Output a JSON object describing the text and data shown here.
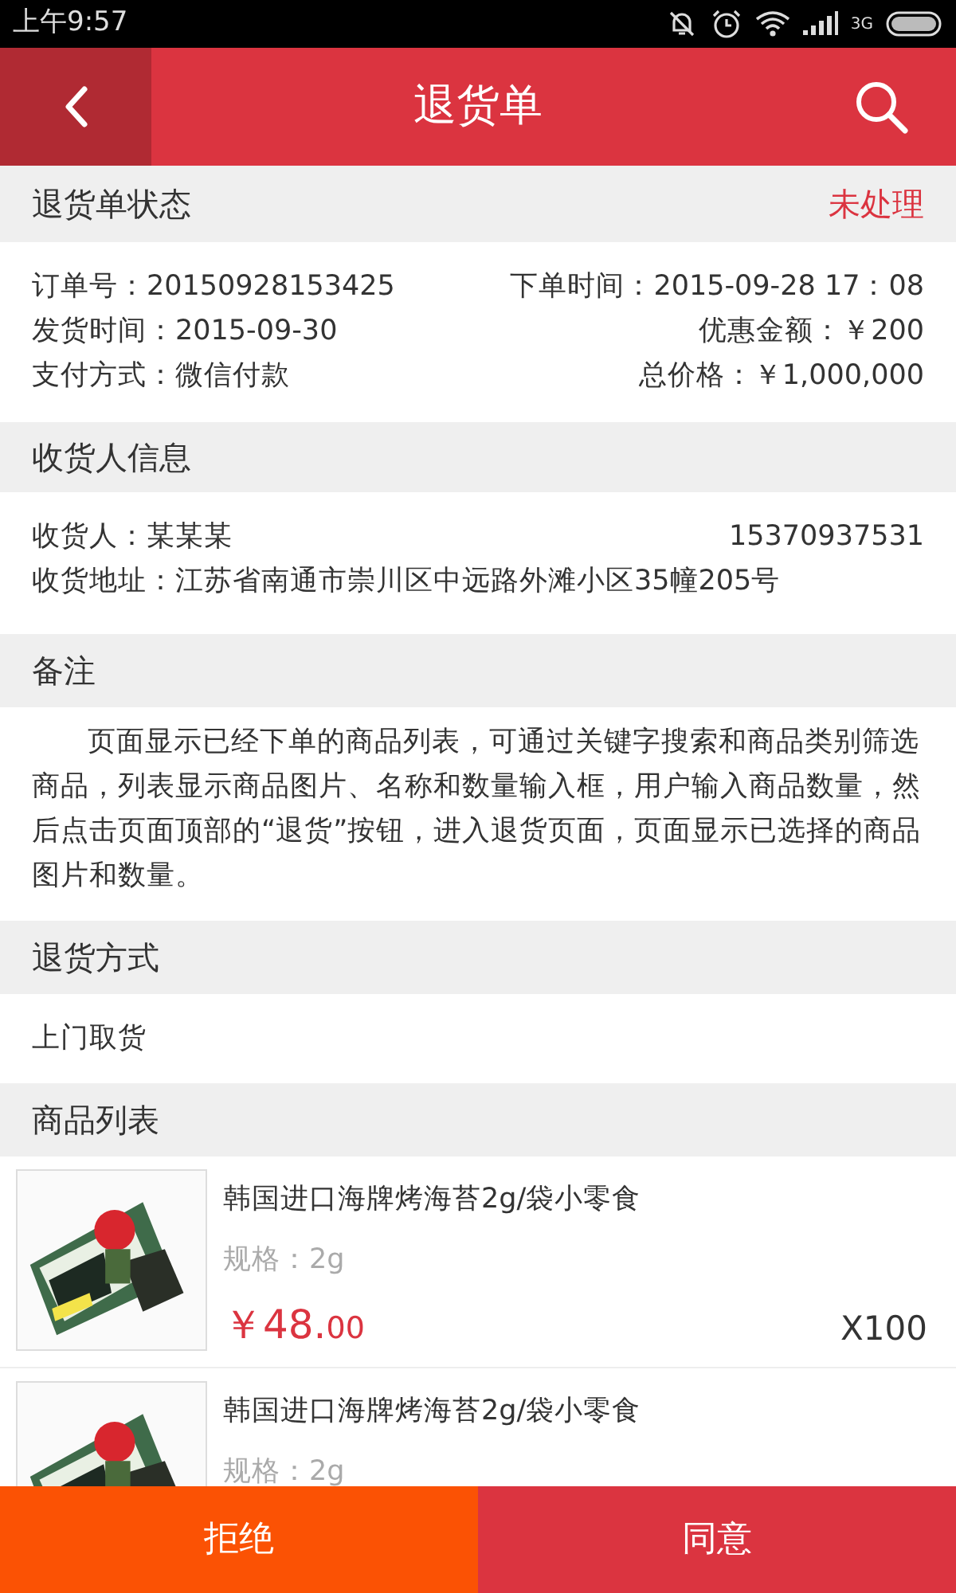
{
  "status_bar": {
    "time": "上午9:57",
    "network": "3G"
  },
  "header": {
    "title": "退货单"
  },
  "status_section": {
    "title": "退货单状态",
    "value": "未处理"
  },
  "order_info": [
    {
      "left": "订单号：20150928153425",
      "right": "下单时间：2015-09-28  17：08"
    },
    {
      "left": "发货时间：2015-09-30",
      "right": "优惠金额：￥200"
    },
    {
      "left": "支付方式：微信付款",
      "right": "总价格：￥1,000,000"
    }
  ],
  "receiver_section": {
    "title": "收货人信息",
    "name": "收货人：某某某",
    "phone": "15370937531",
    "address": "收货地址：江苏省南通市崇川区中远路外滩小区35幢205号"
  },
  "note_section": {
    "title": "备注",
    "text": "页面显示已经下单的商品列表，可通过关键字搜索和商品类别筛选商品，列表显示商品图片、名称和数量输入框，用户输入商品数量，然后点击页面顶部的“退货”按钮，进入退货页面，页面显示已选择的商品图片和数量。"
  },
  "return_method_section": {
    "title": "退货方式",
    "value": "上门取货"
  },
  "products_section": {
    "title": "商品列表",
    "items": [
      {
        "name": "韩国进口海牌烤海苔2g/袋小零食",
        "spec": "规格：2g",
        "price_main": "￥48.",
        "price_cents": "00",
        "quantity": "X100"
      },
      {
        "name": "韩国进口海牌烤海苔2g/袋小零食",
        "spec": "规格：2g"
      }
    ]
  },
  "bottom_buttons": [
    {
      "label": "拒绝",
      "kind": "reject"
    },
    {
      "label": "同意",
      "kind": "accept"
    }
  ]
}
